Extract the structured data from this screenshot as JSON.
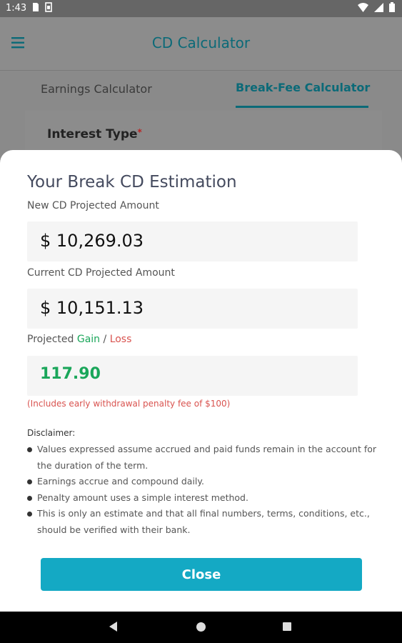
{
  "status_bar": {
    "time": "1:43"
  },
  "app_bar": {
    "title": "CD Calculator"
  },
  "tabs": [
    {
      "label": "Earnings Calculator"
    },
    {
      "label": "Break-Fee Calculator"
    }
  ],
  "background_form": {
    "interest_type_label": "Interest Type",
    "required_mark": "*"
  },
  "sheet": {
    "title": "Your Break CD Estimation",
    "new_cd_label": "New CD Projected Amount",
    "new_cd_value": "$ 10,269.03",
    "current_cd_label": "Current CD Projected Amount",
    "current_cd_value": "$ 10,151.13",
    "projected_label_prefix": "Projected ",
    "projected_gain": "Gain",
    "projected_sep": " / ",
    "projected_loss": "Loss",
    "projected_value": "117.90",
    "penalty_note": "(Includes early withdrawal penalty fee of $100)",
    "disclaimer_title": "Disclaimer:",
    "disclaimer_items": [
      "Values expressed assume accrued and paid funds remain in the account for the duration of the term.",
      "Earnings accrue and compound daily.",
      "Penalty amount uses a simple interest method.",
      "This is only an estimate and that all final numbers, terms, conditions, etc., should be verified with their bank."
    ],
    "close_label": "Close"
  },
  "colors": {
    "accent": "#14a9c4",
    "title_teal": "#0b6a78",
    "gain": "#1aa65a",
    "loss": "#d9534f"
  }
}
